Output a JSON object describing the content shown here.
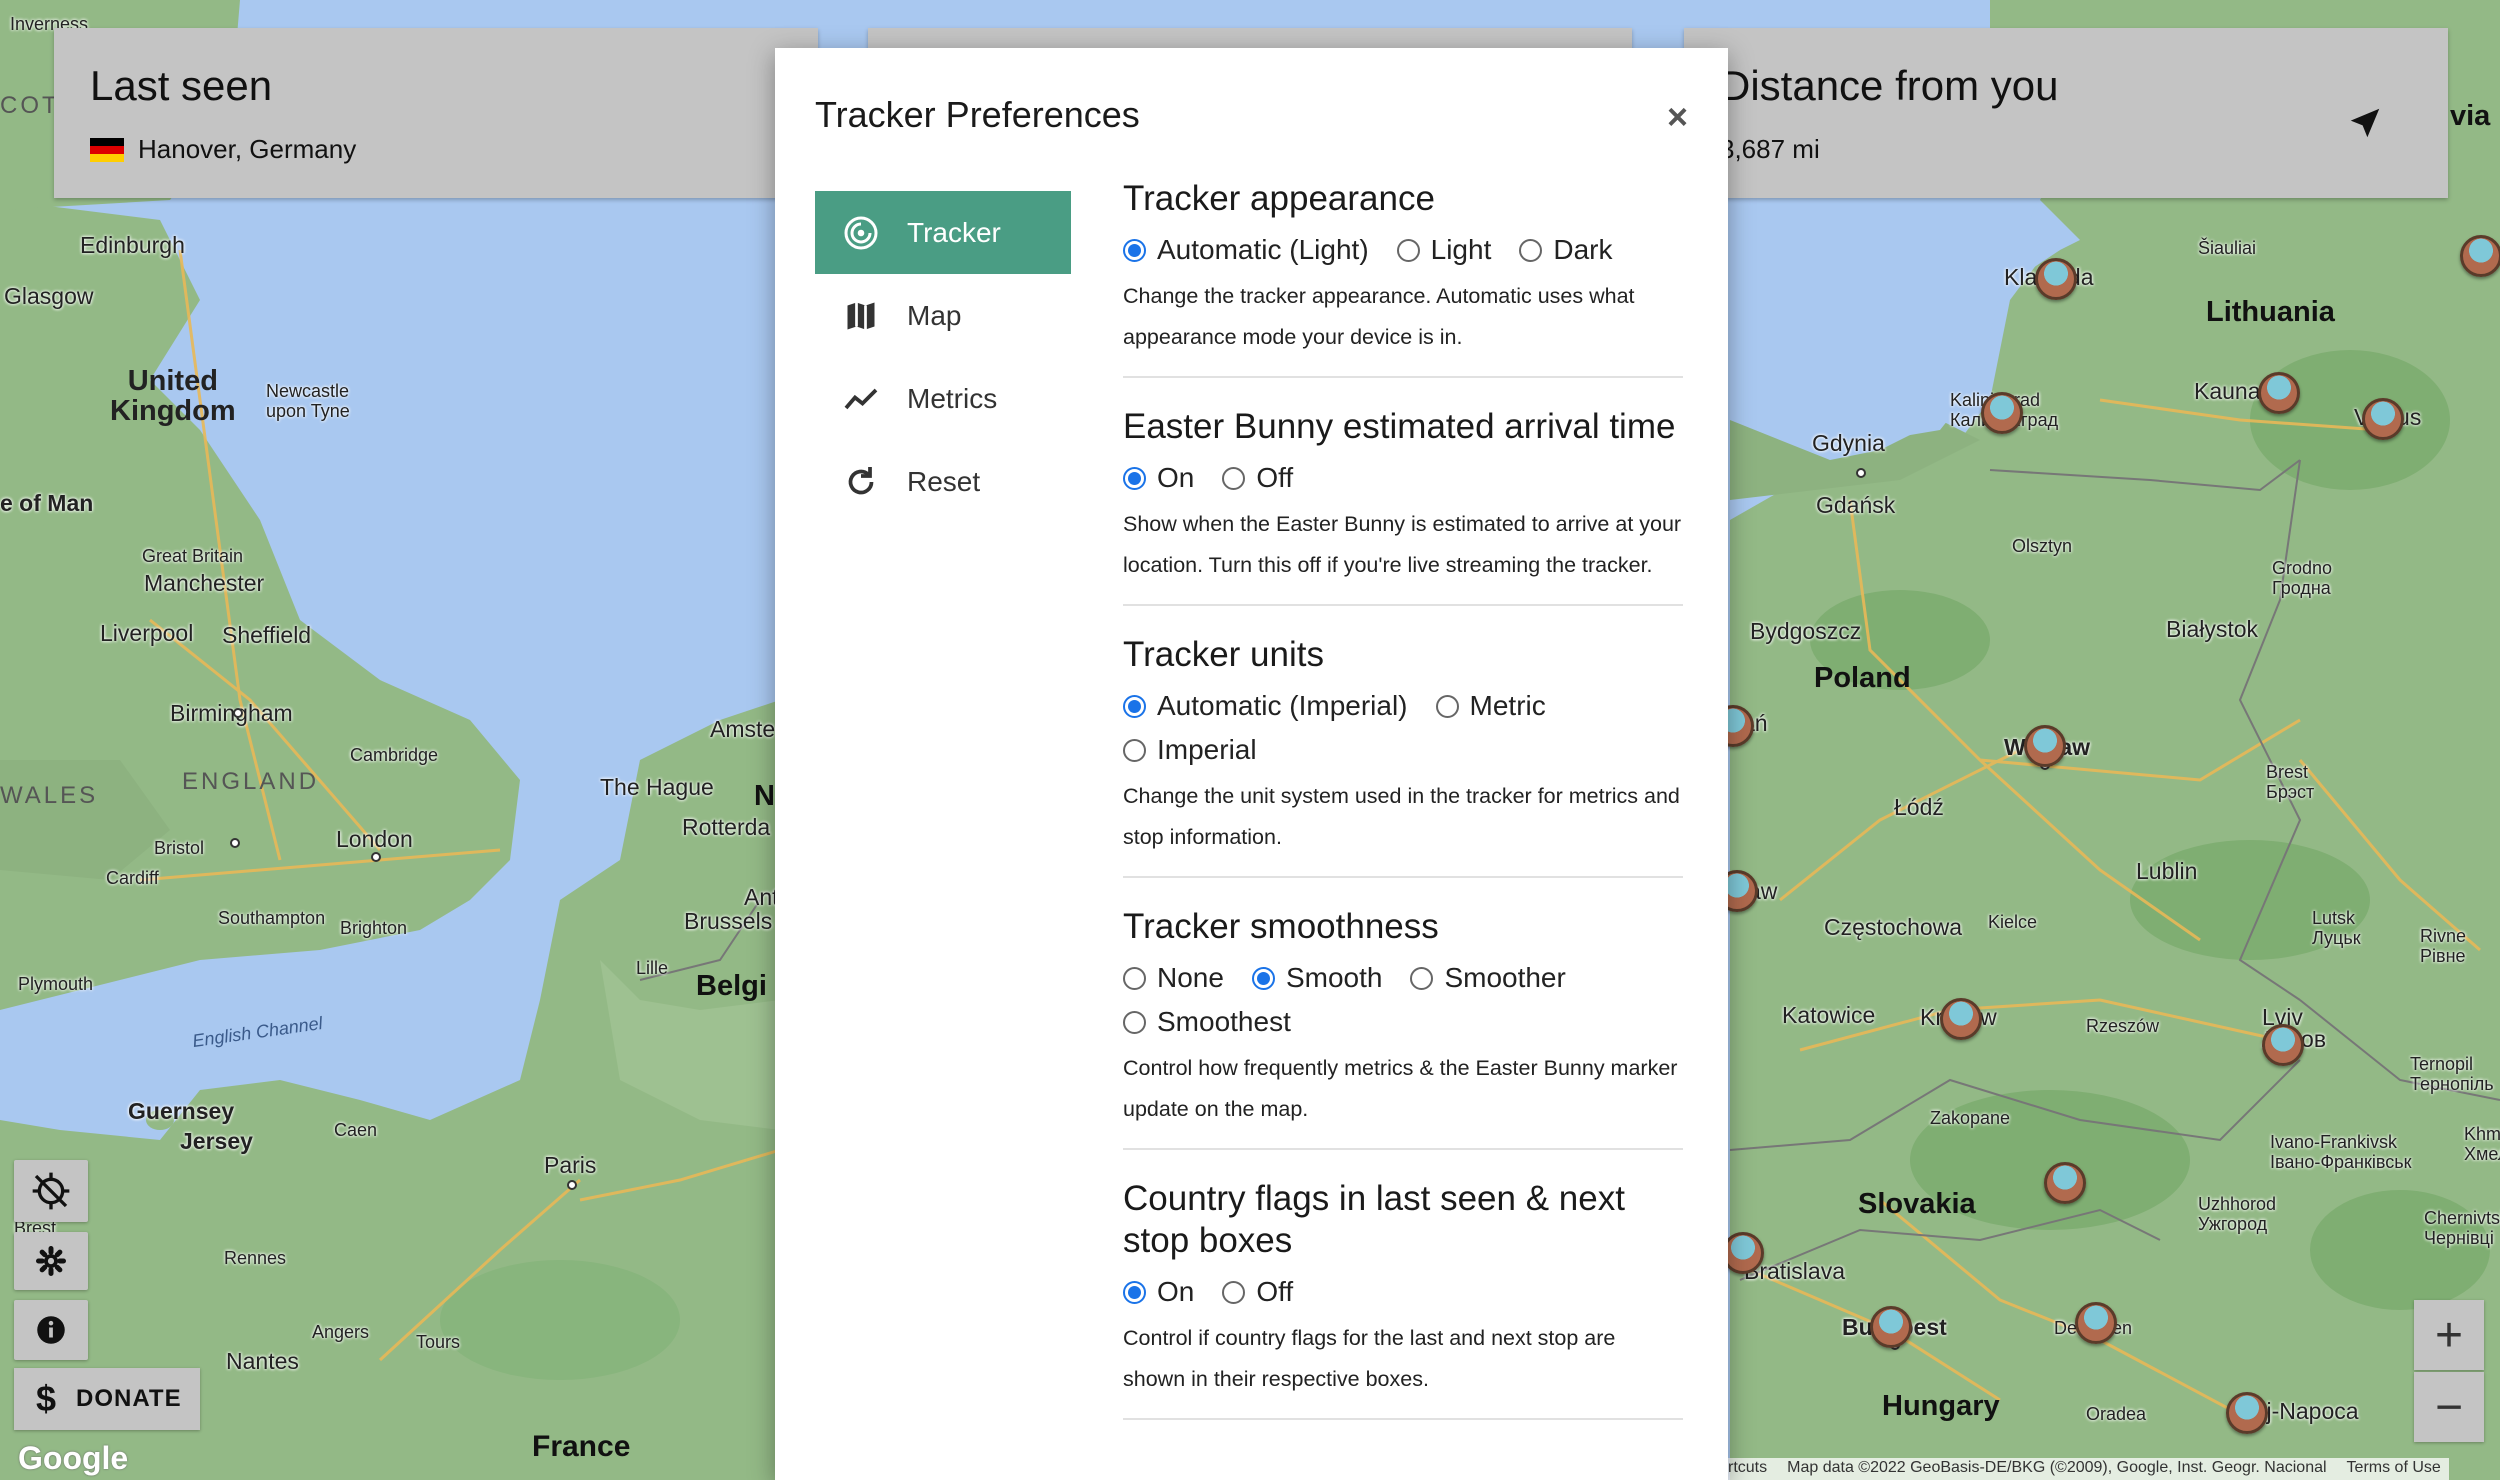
{
  "last_seen": {
    "title": "Last seen",
    "location": "Hanover, Germany"
  },
  "distance": {
    "title": "Distance from you",
    "value": "3,687 mi"
  },
  "controls": {
    "donate_label": "DONATE",
    "zoom_in": "+",
    "zoom_out": "−"
  },
  "google_logo": "Google",
  "attribution": {
    "shortcuts": "rtcuts",
    "map_data": "Map data ©2022 GeoBasis-DE/BKG (©2009), Google, Inst. Geogr. Nacional",
    "terms": "Terms of Use"
  },
  "map_labels": {
    "inverness": "Inverness",
    "scotland": "COT",
    "edinburgh": "Edinburgh",
    "glasgow": "Glasgow",
    "united_kingdom": "United\nKingdom",
    "newcastle": "Newcastle\nupon Tyne",
    "isle_of_man": "e of Man",
    "great_britain": "Great Britain",
    "manchester": "Manchester",
    "liverpool": "Liverpool",
    "sheffield": "Sheffield",
    "birmingham": "Birmingham",
    "cambridge": "Cambridge",
    "england": "ENGLAND",
    "wales": "WALES",
    "bristol": "Bristol",
    "cardiff": "Cardiff",
    "london": "London",
    "southampton": "Southampton",
    "brighton": "Brighton",
    "plymouth": "Plymouth",
    "english_channel": "English Channel",
    "guernsey": "Guernsey",
    "jersey": "Jersey",
    "caen": "Caen",
    "paris": "Paris",
    "rennes": "Rennes",
    "angers": "Angers",
    "tours": "Tours",
    "nantes": "Nantes",
    "france": "France",
    "brest_fr": "Brest",
    "amsterdam": "Amste",
    "the_hague": "The Hague",
    "rotterdam": "Rotterda",
    "antwerp": "Ant",
    "brussels": "Brussels",
    "lille": "Lille",
    "belgium": "Belgi",
    "nl": "N",
    "klaipeda": "Klaipėda",
    "siauliai": "Šiauliai",
    "lithuania": "Lithuania",
    "kaliningrad": "Kaliningrad\nКалининград",
    "kaunas": "Kaunas",
    "vilnius": "Vilnius",
    "gdynia": "Gdynia",
    "gdansk": "Gdańsk",
    "olsztyn": "Olsztyn",
    "grodno": "Grodno\nГродна",
    "bydgoszcz": "Bydgoszcz",
    "bialystok": "Białystok",
    "poland": "Poland",
    "poznan": "ań",
    "warsaw": "Warsaw",
    "brest_by": "Brest\nБрэст",
    "lodz": "Łódź",
    "lublin": "Lublin",
    "wroclaw": "aw",
    "czestochowa": "Częstochowa",
    "kielce": "Kielce",
    "lutsk": "Lutsk\nЛуцьк",
    "rivne": "Rivne\nРівне",
    "katowice": "Katowice",
    "krakow": "Kraków",
    "rzeszow": "Rzeszów",
    "lviv": "Lviv\nЛьвов",
    "ternopil": "Ternopil\nТернопіль",
    "zakopane": "Zakopane",
    "ivano": "Ivano-Frankivsk\nІвано-Франківськ",
    "khm": "Khm\nХмел",
    "slovakia": "Slovakia",
    "uzhhorod": "Uzhhorod\nУжгород",
    "chernivtsi": "Chernivtsi\nЧернівці",
    "bratislava": "Bratislava",
    "budapest": "Budapest",
    "debrecen": "Debrecen",
    "hungary": "Hungary",
    "oradea": "Oradea",
    "cluj": "Cluj-Napoca",
    "via": "via"
  },
  "modal": {
    "title": "Tracker Preferences",
    "close": "×",
    "nav": [
      {
        "label": "Tracker"
      },
      {
        "label": "Map"
      },
      {
        "label": "Metrics"
      },
      {
        "label": "Reset"
      }
    ],
    "sections": [
      {
        "title": "Tracker appearance",
        "options": [
          "Automatic (Light)",
          "Light",
          "Dark"
        ],
        "selected": "Automatic (Light)",
        "description": "Change the tracker appearance. Automatic uses what appearance mode your device is in."
      },
      {
        "title": "Easter Bunny estimated arrival time",
        "options": [
          "On",
          "Off"
        ],
        "selected": "On",
        "description": "Show when the Easter Bunny is estimated to arrive at your location. Turn this off if you're live streaming the tracker."
      },
      {
        "title": "Tracker units",
        "options": [
          "Automatic (Imperial)",
          "Metric",
          "Imperial"
        ],
        "selected": "Automatic (Imperial)",
        "description": "Change the unit system used in the tracker for metrics and stop information."
      },
      {
        "title": "Tracker smoothness",
        "options": [
          "None",
          "Smooth",
          "Smoother",
          "Smoothest"
        ],
        "selected": "Smooth",
        "description": "Control how frequently metrics & the Easter Bunny marker update on the map."
      },
      {
        "title": "Country flags in last seen & next stop boxes",
        "options": [
          "On",
          "Off"
        ],
        "selected": "On",
        "description": "Control if country flags for the last and next stop are shown in their respective boxes."
      }
    ]
  },
  "colors": {
    "accent": "#4a9d84",
    "radio": "#1a73e8",
    "water": "#aadaff",
    "land": "#8fbc8f"
  },
  "icons": {
    "nav": [
      "radar-icon",
      "map-icon",
      "metrics-icon",
      "reset-icon"
    ],
    "controls": [
      "location-off-icon",
      "gear-icon",
      "info-icon",
      "dollar-icon"
    ]
  }
}
